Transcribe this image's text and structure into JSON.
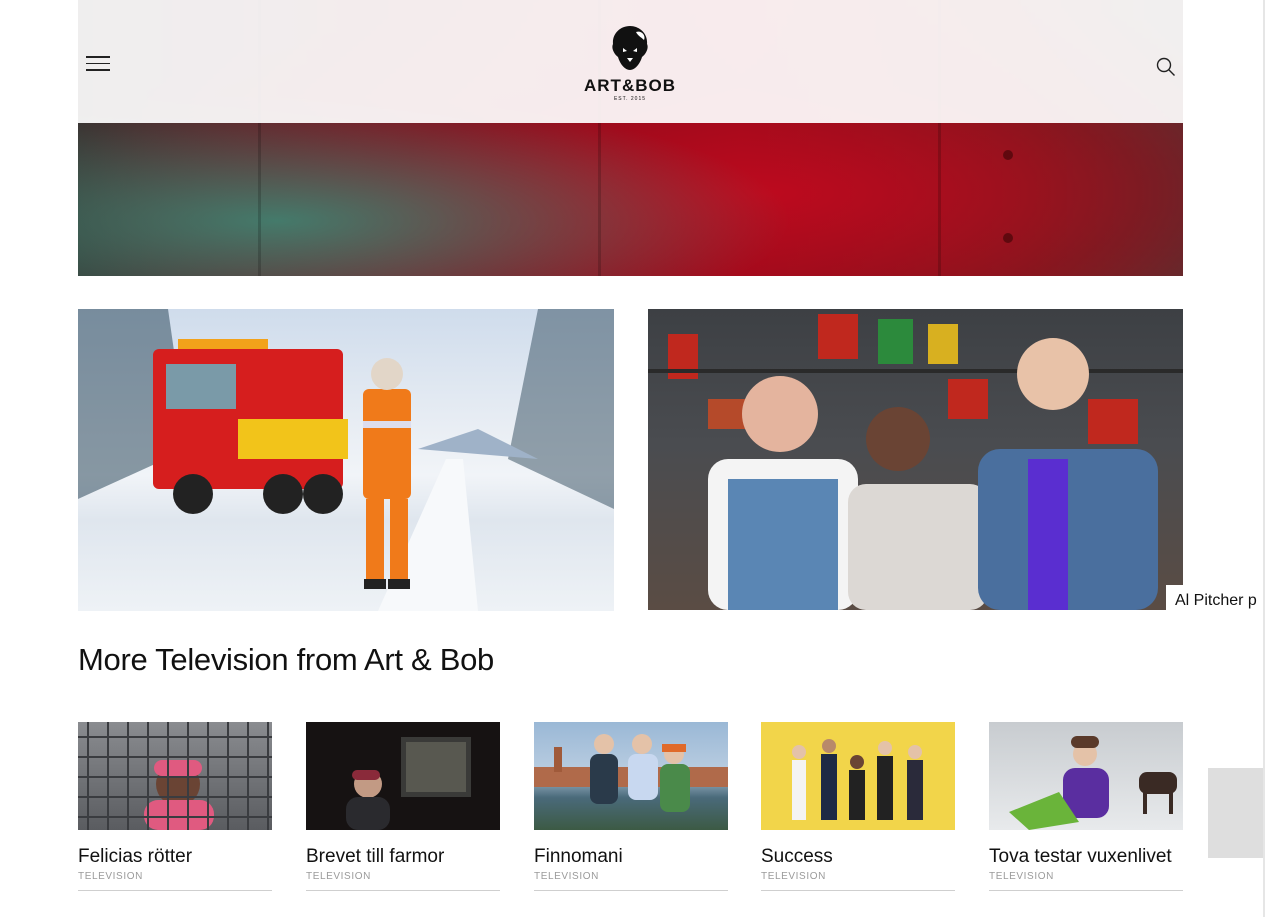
{
  "header": {
    "logo_text": "ART&BOB",
    "logo_est": "EST. 2015",
    "menu_icon": "hamburger-menu-icon",
    "search_icon": "search-icon"
  },
  "photo_caption": "Al Pitcher p",
  "section": {
    "title": "More Television from Art & Bob"
  },
  "cards": [
    {
      "title": "Felicias rötter",
      "category": "TELEVISION"
    },
    {
      "title": "Brevet till farmor",
      "category": "TELEVISION"
    },
    {
      "title": "Finnomani",
      "category": "TELEVISION"
    },
    {
      "title": "Success",
      "category": "TELEVISION"
    },
    {
      "title": "Tova testar vuxenlivet",
      "category": "TELEVISION"
    }
  ],
  "colors": {
    "hero_red": "#a80a1e",
    "text": "#111111",
    "category_gray": "#9a9a9a",
    "success_yellow": "#f2d54a"
  }
}
